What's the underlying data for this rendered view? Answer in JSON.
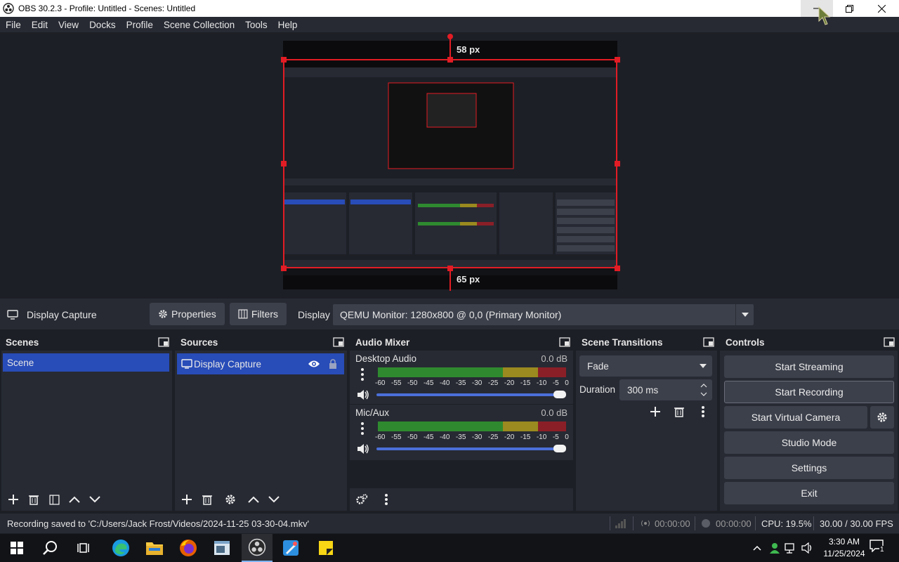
{
  "window": {
    "title": "OBS 30.2.3 - Profile: Untitled - Scenes: Untitled",
    "min_icon": "minimize-icon",
    "max_icon": "restore-icon",
    "close_icon": "close-icon"
  },
  "menu": [
    "File",
    "Edit",
    "View",
    "Docks",
    "Profile",
    "Scene Collection",
    "Tools",
    "Help"
  ],
  "preview": {
    "top_crop_label": "58 px",
    "bottom_crop_label": "65 px",
    "accent": "#e21c24"
  },
  "context": {
    "source_label": "Display Capture",
    "properties_label": "Properties",
    "filters_label": "Filters",
    "display_label": "Display",
    "display_value": "QEMU Monitor: 1280x800 @ 0,0 (Primary Monitor)"
  },
  "scenes": {
    "title": "Scenes",
    "items": [
      "Scene"
    ]
  },
  "sources": {
    "title": "Sources",
    "items": [
      "Display Capture"
    ]
  },
  "mixer": {
    "title": "Audio Mixer",
    "ticks": [
      "-60",
      "-55",
      "-50",
      "-45",
      "-40",
      "-35",
      "-30",
      "-25",
      "-20",
      "-15",
      "-10",
      "-5",
      "0"
    ],
    "tracks": [
      {
        "name": "Desktop Audio",
        "db": "0.0 dB"
      },
      {
        "name": "Mic/Aux",
        "db": "0.0 dB"
      }
    ]
  },
  "transitions": {
    "title": "Scene Transitions",
    "selected": "Fade",
    "duration_label": "Duration",
    "duration_value": "300 ms"
  },
  "controls": {
    "title": "Controls",
    "start_streaming": "Start Streaming",
    "start_recording": "Start Recording",
    "start_virtual_camera": "Start Virtual Camera",
    "studio_mode": "Studio Mode",
    "settings": "Settings",
    "exit": "Exit"
  },
  "status": {
    "message": "Recording saved to 'C:/Users/Jack Frost/Videos/2024-11-25 03-30-04.mkv'",
    "stream_time": "00:00:00",
    "record_time": "00:00:00",
    "cpu": "CPU: 19.5%",
    "fps": "30.00 / 30.00 FPS"
  },
  "taskbar": {
    "time": "3:30 AM",
    "date": "11/25/2024",
    "notification_count": "1"
  },
  "colors": {
    "selection": "#284cb8",
    "panel": "#272a33",
    "background": "#1d1f26",
    "button": "#3c404b",
    "meter_green": "#2f8a2f",
    "meter_yellow": "#9a8a1f",
    "meter_red": "#8a1f28"
  }
}
